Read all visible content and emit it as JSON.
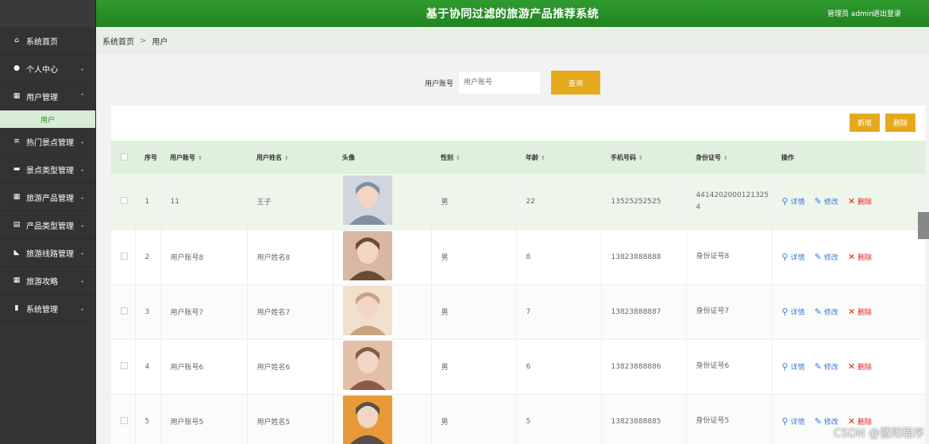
{
  "header": {
    "title": "基于协同过滤的旅游产品推荐系统",
    "user": "管理员 admin",
    "logout": "退出登录"
  },
  "sidebar": {
    "items": [
      {
        "label": "系统首页",
        "icon": "home-icon",
        "glyph": "⌂"
      },
      {
        "label": "个人中心",
        "icon": "user-icon",
        "glyph": "●"
      },
      {
        "label": "用户管理",
        "icon": "grid-icon",
        "glyph": "▦"
      },
      {
        "label": "热门景点管理",
        "icon": "list-icon",
        "glyph": "≡"
      },
      {
        "label": "景点类型管理",
        "icon": "ticket-icon",
        "glyph": "▬"
      },
      {
        "label": "旅游产品管理",
        "icon": "grid-icon",
        "glyph": "▦"
      },
      {
        "label": "产品类型管理",
        "icon": "clipboard-icon",
        "glyph": "▤"
      },
      {
        "label": "旅游线路管理",
        "icon": "thumb-icon",
        "glyph": "◣"
      },
      {
        "label": "旅游攻略",
        "icon": "grid-icon",
        "glyph": "▦"
      },
      {
        "label": "系统管理",
        "icon": "book-icon",
        "glyph": "▮"
      }
    ],
    "sub_item": "用户"
  },
  "breadcrumb": {
    "home": "系统首页",
    "sep": ">",
    "current": "用户"
  },
  "search": {
    "label": "用户账号",
    "placeholder": "用户账号",
    "button": "查询"
  },
  "actions": {
    "add": "新增",
    "delete": "删除"
  },
  "table": {
    "headers": [
      "序号",
      "用户账号",
      "用户姓名",
      "头像",
      "性别",
      "年龄",
      "手机号码",
      "身份证号",
      "操作"
    ],
    "rows": [
      {
        "no": "1",
        "account": "11",
        "name": "王子",
        "gender": "男",
        "age": "22",
        "phone": "13525252525",
        "idcard": "4414202000121325\n4"
      },
      {
        "no": "2",
        "account": "用户账号8",
        "name": "用户姓名8",
        "gender": "男",
        "age": "8",
        "phone": "13823888888",
        "idcard": "身份证号8"
      },
      {
        "no": "3",
        "account": "用户账号7",
        "name": "用户姓名7",
        "gender": "男",
        "age": "7",
        "phone": "13823888887",
        "idcard": "身份证号7"
      },
      {
        "no": "4",
        "account": "用户账号6",
        "name": "用户姓名6",
        "gender": "男",
        "age": "6",
        "phone": "13823888886",
        "idcard": "身份证号6"
      },
      {
        "no": "5",
        "account": "用户账号5",
        "name": "用户姓名5",
        "gender": "男",
        "age": "5",
        "phone": "13823888885",
        "idcard": "身份证号5"
      }
    ],
    "ops": {
      "detail": "详情",
      "edit": "修改",
      "delete": "删除"
    }
  },
  "watermark": "CSDN @暨阳程序",
  "colors": {
    "header": "#2f9a2f",
    "sidebar": "#333333",
    "button": "#e5a91c",
    "table_head": "#dff0dc"
  }
}
